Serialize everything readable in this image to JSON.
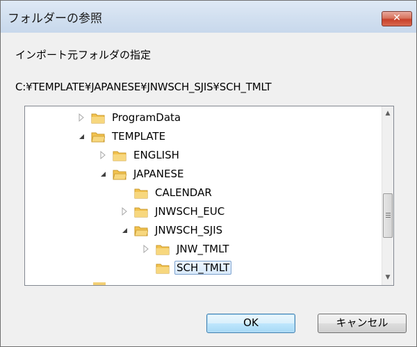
{
  "window": {
    "title": "フォルダーの参照",
    "close_glyph": "✕"
  },
  "instruction": "インポート元フォルダの指定",
  "current_path": "C:¥TEMPLATE¥JAPANESE¥JNWSCH_SJIS¥SCH_TMLT",
  "tree": {
    "items": [
      {
        "label": "ProgramData",
        "state": "collapsed"
      },
      {
        "label": "TEMPLATE",
        "state": "expanded"
      },
      {
        "label": "ENGLISH",
        "state": "collapsed"
      },
      {
        "label": "JAPANESE",
        "state": "expanded"
      },
      {
        "label": "CALENDAR",
        "state": "none"
      },
      {
        "label": "JNWSCH_EUC",
        "state": "collapsed"
      },
      {
        "label": "JNWSCH_SJIS",
        "state": "expanded"
      },
      {
        "label": "JNW_TMLT",
        "state": "collapsed"
      },
      {
        "label": "SCH_TMLT",
        "state": "none",
        "selected": true
      }
    ]
  },
  "buttons": {
    "ok": "OK",
    "cancel": "キャンセル"
  },
  "colors": {
    "folder": "#f2c24f",
    "selection": "#cce4f7",
    "close_button": "#c7412b"
  }
}
